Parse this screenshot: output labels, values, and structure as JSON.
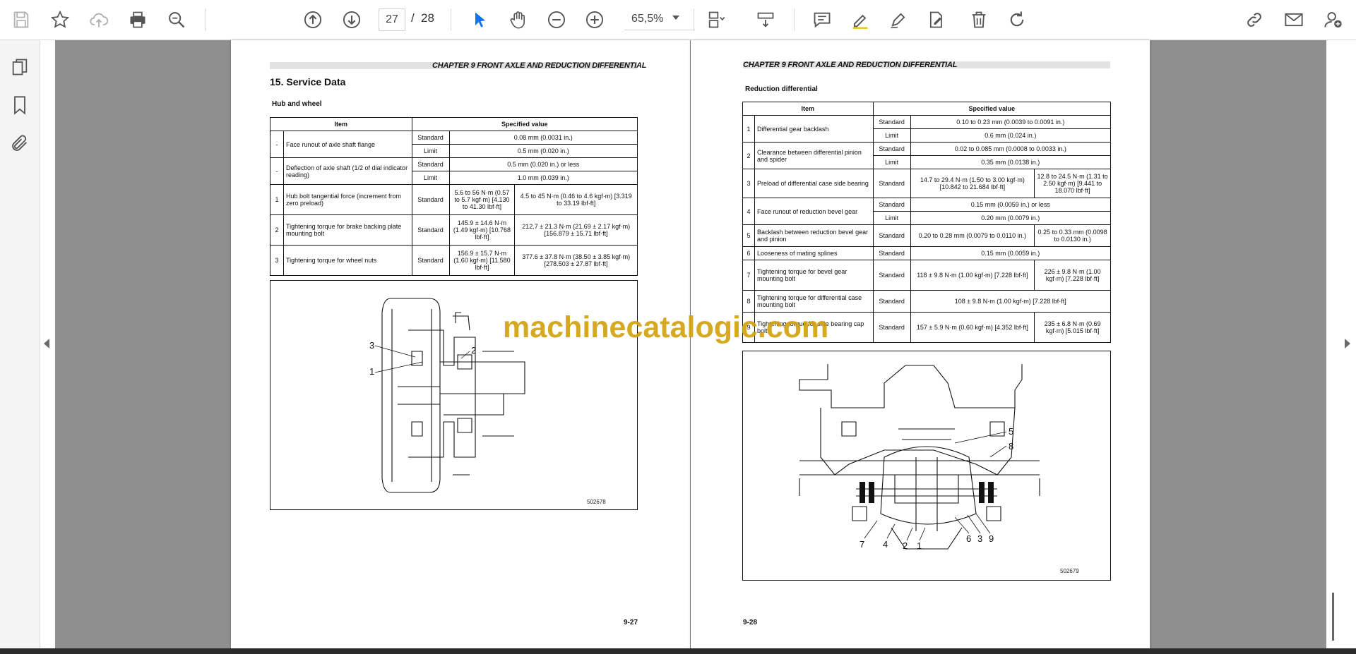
{
  "toolbar": {
    "current_page": "27",
    "page_separator": "/",
    "total_pages": "28",
    "zoom": "65,5%",
    "icons": [
      "save-icon",
      "bookmark-star-icon",
      "cloud-upload-icon",
      "print-icon",
      "zoom-search-icon",
      "page-up-icon",
      "page-down-icon",
      "select-cursor-icon",
      "hand-tool-icon",
      "zoom-out-icon",
      "zoom-in-icon",
      "page-fit-icon",
      "scroll-mode-icon",
      "comment-icon",
      "highlight-pen-icon",
      "draw-pen-icon",
      "fill-sign-icon",
      "delete-icon",
      "rotate-icon",
      "share-link-icon",
      "email-icon",
      "user-add-icon"
    ]
  },
  "left_panel": {
    "icons": [
      "pages-icon",
      "bookmarks-icon",
      "attachments-icon"
    ]
  },
  "colors": {
    "watermark": "#d2a210",
    "viewer_bg": "#8f8f8f"
  },
  "watermark": "machinecatalogic.com",
  "left_page": {
    "chapter": "CHAPTER 9 FRONT AXLE AND REDUCTION DIFFERENTIAL",
    "section": "15.  Service Data",
    "subsection": "Hub and wheel",
    "headers": {
      "item": "Item",
      "value": "Specified value"
    },
    "rows": [
      {
        "no": "-",
        "item": "Face runout of axle shaft flange",
        "k1": "Standard",
        "v1": "0.08 mm (0.0031 in.)",
        "k2": "Limit",
        "v2": "0.5 mm (0.020 in.)"
      },
      {
        "no": "-",
        "item": "Deflection of axle shaft (1/2 of dial indicator reading)",
        "k1": "Standard",
        "v1": "0.5 mm (0.020 in.) or less",
        "k2": "Limit",
        "v2": "1.0 mm (0.039 in.)"
      },
      {
        "no": "1",
        "item": "Hub bolt tangential force (increment from zero preload)",
        "k1": "Standard",
        "a": "5.6 to 56 N·m (0.57 to 5.7 kgf·m) [4.130 to 41.30 lbf·ft]",
        "b": "4.5 to 45 N·m (0.46 to 4.6 kgf·m) [3.319 to 33.19 lbf·ft]"
      },
      {
        "no": "2",
        "item": "Tightening torque for brake backing plate mounting bolt",
        "k1": "Standard",
        "a": "145.9 ± 14.6 N·m (1.49 kgf·m) [10.768 lbf·ft]",
        "b": "212.7 ± 21.3 N·m (21.69 ± 2.17 kgf·m) [156.879 ± 15.71 lbf·ft]"
      },
      {
        "no": "3",
        "item": "Tightening torque for wheel nuts",
        "k1": "Standard",
        "a": "156.9 ± 15.7 N·m (1.60 kgf·m) [11.580 lbf·ft]",
        "b": "377.6 ± 37.8 N·m (38.50 ± 3.85 kgf·m) [278.503 ± 27.87 lbf·ft]"
      }
    ],
    "figure_labels": [
      "3",
      "1",
      "2"
    ],
    "figure_id": "502678",
    "page_number": "9-27"
  },
  "right_page": {
    "chapter": "CHAPTER 9 FRONT AXLE AND REDUCTION DIFFERENTIAL",
    "subsection": "Reduction differential",
    "headers": {
      "item": "Item",
      "value": "Specified value"
    },
    "rows": [
      {
        "no": "1",
        "item": "Differential gear backlash",
        "k1": "Standard",
        "v1": "0.10 to 0.23 mm (0.0039 to 0.0091 in.)",
        "k2": "Limit",
        "v2": "0.6 mm (0.024 in.)"
      },
      {
        "no": "2",
        "item": "Clearance between differential pinion and spider",
        "k1": "Standard",
        "v1": "0.02 to 0.085 mm (0.0008 to 0.0033 in.)",
        "k2": "Limit",
        "v2": "0.35 mm (0.0138 in.)"
      },
      {
        "no": "3",
        "item": "Preload of differential case side bearing",
        "k1": "Standard",
        "a": "14.7 to 29.4 N·m (1.50 to 3.00 kgf·m) [10.842 to 21.684 lbf·ft]",
        "b": "12.8 to 24.5 N·m (1.31 to 2.50 kgf·m) [9.441 to 18.070 lbf·ft]"
      },
      {
        "no": "4",
        "item": "Face runout of reduction bevel gear",
        "k1": "Standard",
        "v1": "0.15 mm (0.0059 in.) or less",
        "k2": "Limit",
        "v2": "0.20 mm (0.0079 in.)"
      },
      {
        "no": "5",
        "item": "Backlash between reduction bevel gear and pinion",
        "k1": "Standard",
        "a": "0.20 to 0.28 mm (0.0079 to 0.0110 in.)",
        "b": "0.25 to 0.33 mm (0.0098 to 0.0130 in.)"
      },
      {
        "no": "6",
        "item": "Looseness of mating splines",
        "k1": "Standard",
        "v1": "0.15 mm (0.0059 in.)"
      },
      {
        "no": "7",
        "item": "Tightening torque for bevel gear mounting bolt",
        "k1": "Standard",
        "a": "118 ± 9.8 N·m (1.00 kgf·m) [7.228 lbf·ft]",
        "b": "226 ± 9.8 N·m (1.00 kgf·m) [7.228 lbf·ft]"
      },
      {
        "no": "8",
        "item": "Tightening torque for differential case mounting bolt",
        "k1": "Standard",
        "v1": "108 ± 9.8 N·m (1.00 kgf·m) [7.228 lbf·ft]"
      },
      {
        "no": "9",
        "item": "Tightening torque for side bearing cap bolt",
        "k1": "Standard",
        "a": "157 ± 5.9 N·m (0.60 kgf·m) [4.352 lbf·ft]",
        "b": "235 ± 6.8 N·m (0.69 kgf·m) [5.015 lbf·ft]"
      }
    ],
    "figure_labels": [
      "5",
      "8",
      "7",
      "4",
      "2",
      "1",
      "6",
      "3",
      "9"
    ],
    "figure_id": "502679",
    "page_number": "9-28"
  }
}
